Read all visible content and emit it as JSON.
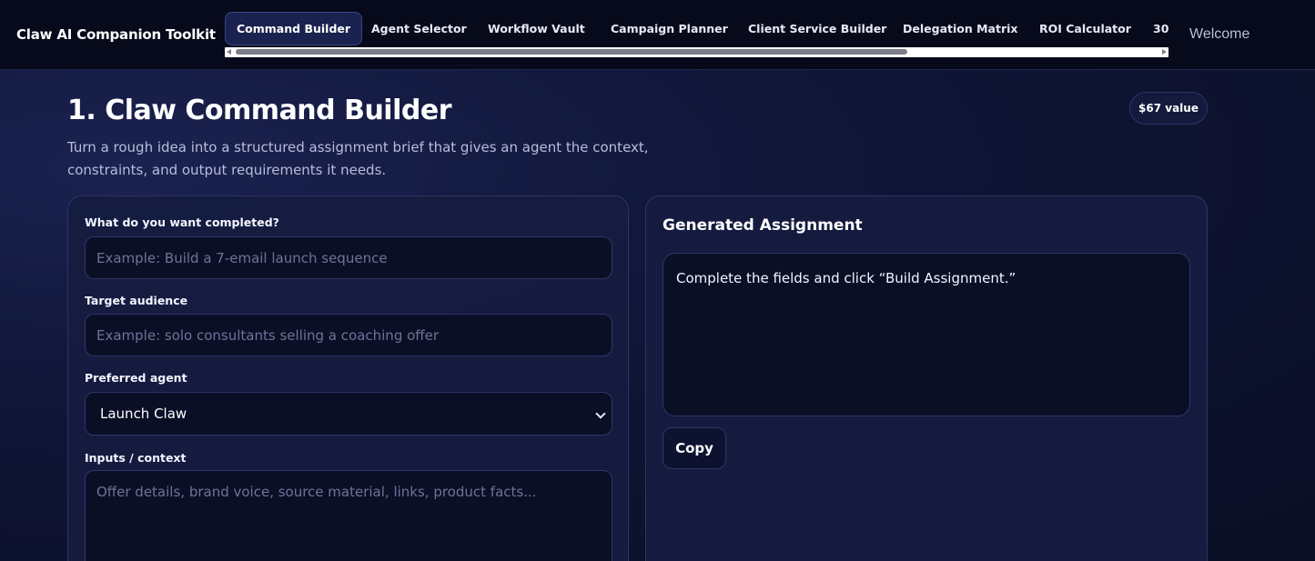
{
  "header": {
    "brand": "Claw AI Companion Toolkit",
    "tabs": [
      {
        "label": "Command Builder",
        "active": true
      },
      {
        "label": "Agent Selector",
        "active": false
      },
      {
        "label": "Workflow Vault",
        "active": false
      },
      {
        "label": "Campaign Planner",
        "active": false
      },
      {
        "label": "Client Service Builder",
        "active": false
      },
      {
        "label": "Delegation Matrix",
        "active": false
      },
      {
        "label": "ROI Calculator",
        "active": false
      },
      {
        "label": "30",
        "active": false
      }
    ],
    "welcome": "Welcome"
  },
  "main": {
    "title": "1. Claw Command Builder",
    "value_badge": "$67 value",
    "subtitle": "Turn a rough idea into a structured assignment brief that gives an agent the context, constraints, and output requirements it needs."
  },
  "form": {
    "task_label": "What do you want completed?",
    "task_placeholder": "Example: Build a 7-email launch sequence",
    "audience_label": "Target audience",
    "audience_placeholder": "Example: solo consultants selling a coaching offer",
    "agent_label": "Preferred agent",
    "agent_selected": "Launch Claw",
    "inputs_label": "Inputs / context",
    "inputs_placeholder": "Offer details, brand voice, source material, links, product facts..."
  },
  "output": {
    "heading": "Generated Assignment",
    "text": "Complete the fields and click “Build Assignment.”",
    "copy_label": "Copy"
  },
  "colors": {
    "background": "#0a0e24",
    "panel": "#161c40",
    "input_bg": "#0b0f26",
    "border": "#2e3668",
    "accent_active_tab": "#1a2250"
  }
}
